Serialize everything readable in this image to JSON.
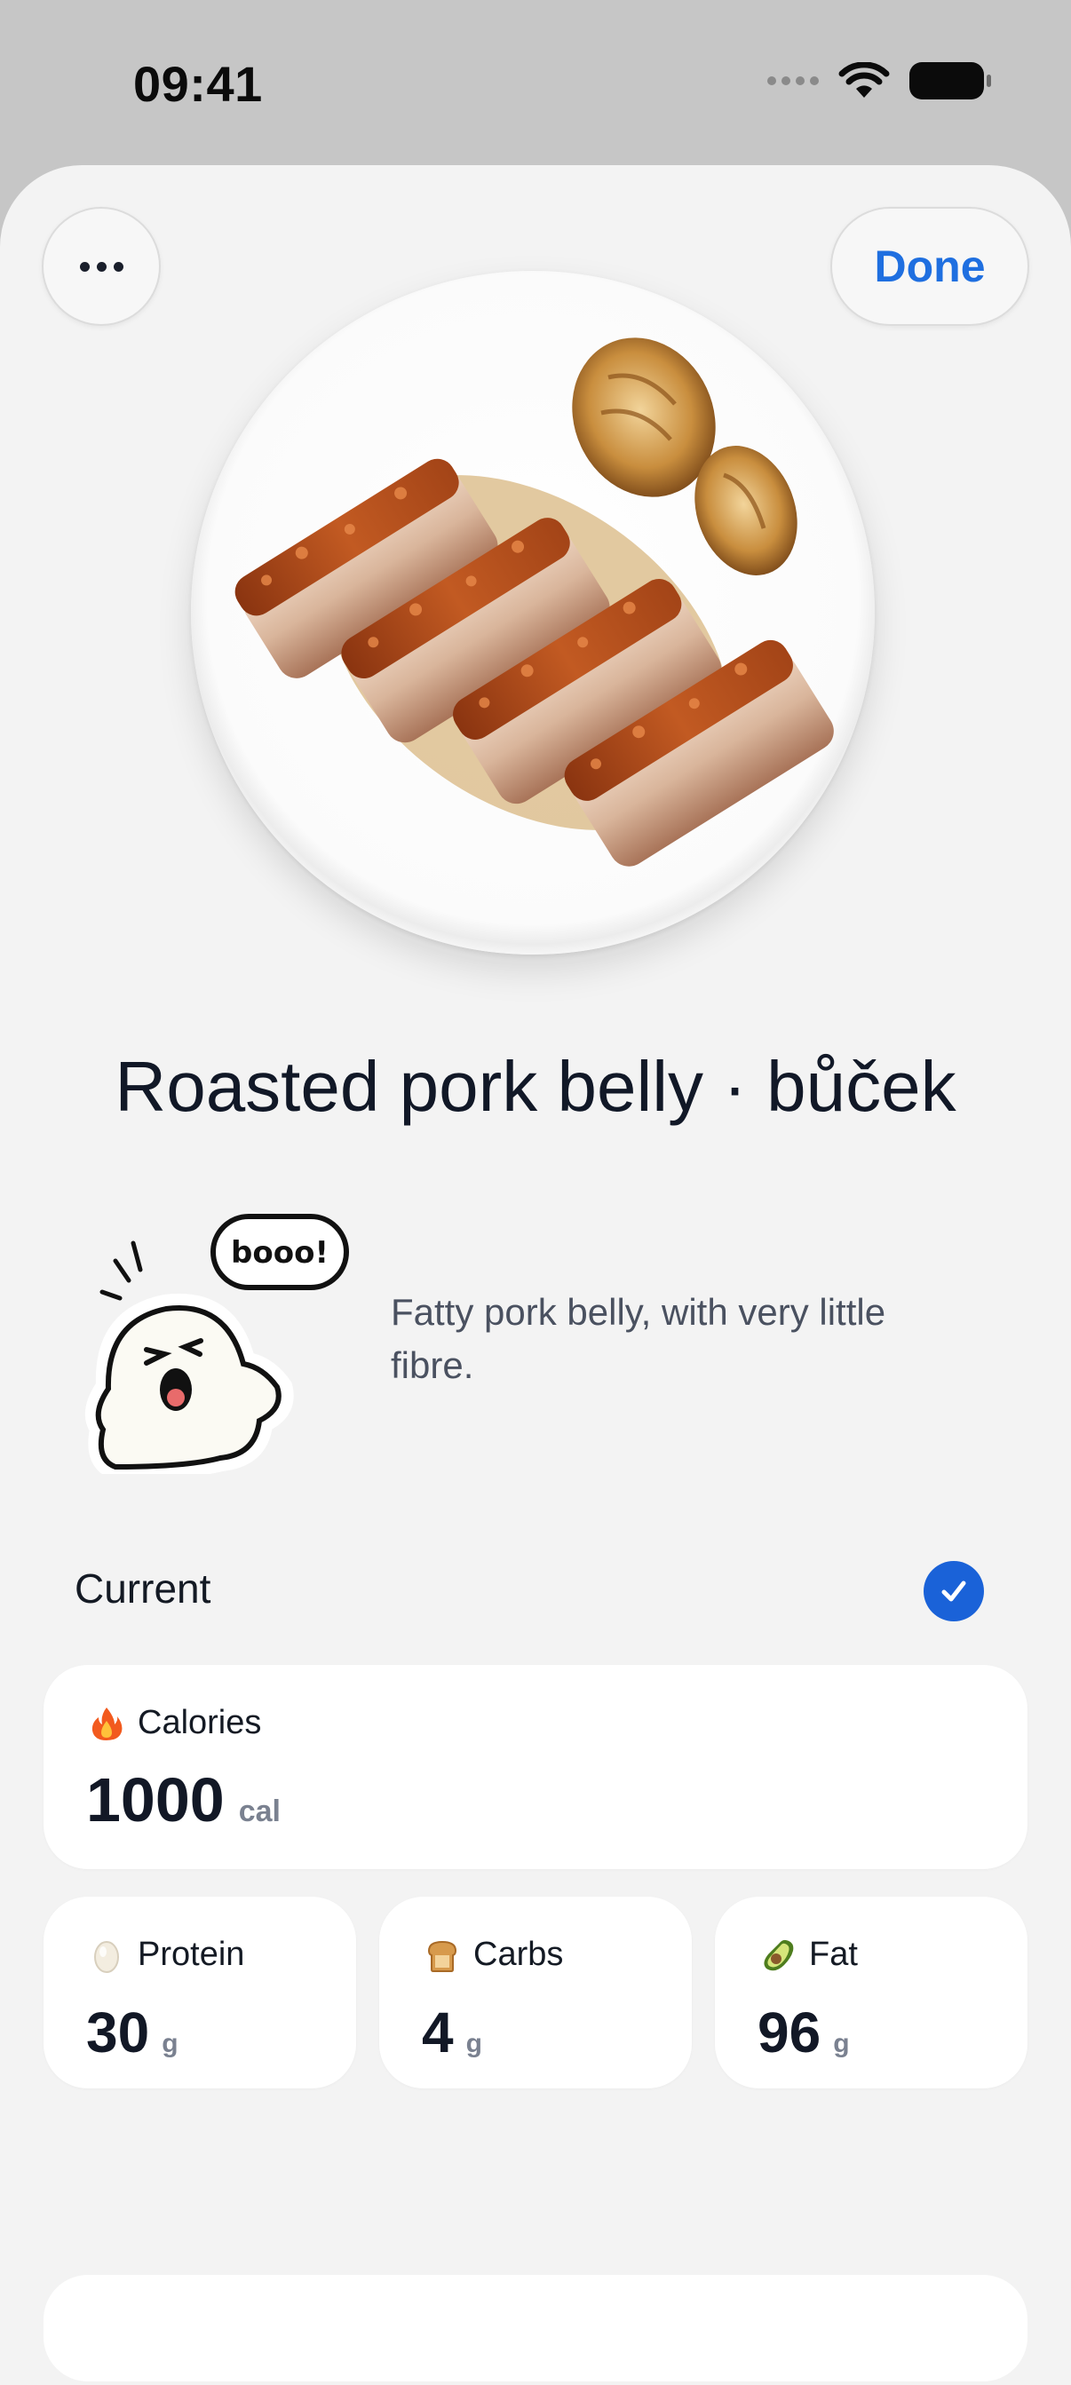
{
  "status_bar": {
    "time": "09:41"
  },
  "header": {
    "more_icon": "ellipsis-icon",
    "done_label": "Done"
  },
  "dish": {
    "title": "Roasted pork belly · bůček",
    "description": "Fatty pork belly, with very little fibre.",
    "mascot_speech": "booo!"
  },
  "portion": {
    "label": "Current",
    "selected": true
  },
  "nutrition": {
    "calories": {
      "label": "Calories",
      "value": "1000",
      "unit": "cal",
      "icon": "fire-icon"
    },
    "protein": {
      "label": "Protein",
      "value": "30",
      "unit": "g",
      "icon": "egg-icon"
    },
    "carbs": {
      "label": "Carbs",
      "value": "4",
      "unit": "g",
      "icon": "bread-icon"
    },
    "fat": {
      "label": "Fat",
      "value": "96",
      "unit": "g",
      "icon": "avocado-icon"
    }
  },
  "colors": {
    "accent": "#1f6fe0",
    "check": "#1a62d8",
    "sheet": "#f3f3f3"
  }
}
